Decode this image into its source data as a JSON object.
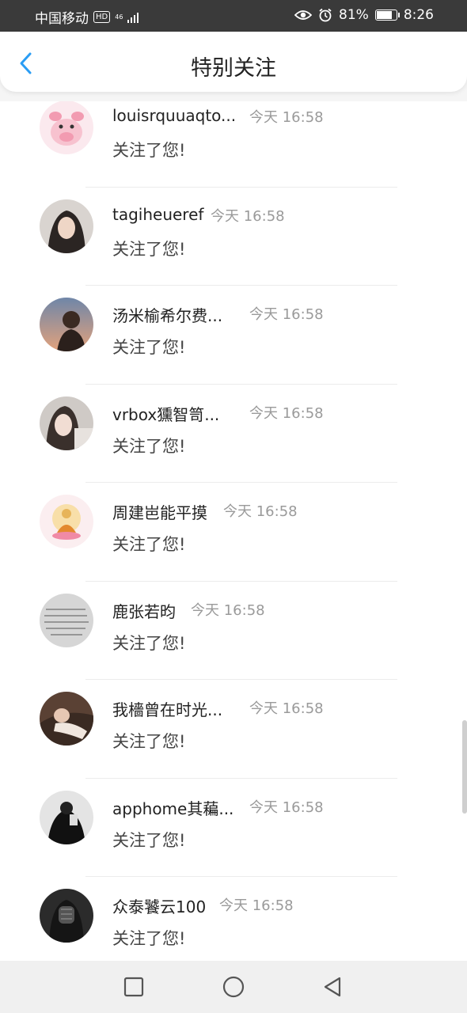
{
  "status_bar": {
    "carrier": "中国移动",
    "hd_badge": "HD",
    "network": "46",
    "battery": "81%",
    "battery_level": 0.81,
    "time": "8:26",
    "icons": [
      "eye-icon",
      "alarm-icon",
      "battery-icon"
    ]
  },
  "header": {
    "title": "特别关注",
    "back_icon": "chevron-left-icon"
  },
  "list": [
    {
      "name": "louisrquuaqto...",
      "time": "今天 16:58",
      "message": "关注了您!",
      "avatar": "pig-avatar"
    },
    {
      "name": "tagiheueref",
      "time": "今天 16:58",
      "message": "关注了您!",
      "avatar": "woman-portrait-avatar"
    },
    {
      "name": "汤米榆希尔费...",
      "time": "今天 16:58",
      "message": "关注了您!",
      "avatar": "sunset-portrait-avatar"
    },
    {
      "name": "vrbox獯智笥...",
      "time": "今天 16:58",
      "message": "关注了您!",
      "avatar": "girl-portrait-avatar"
    },
    {
      "name": "周建岜能平摸",
      "time": "今天 16:58",
      "message": "关注了您!",
      "avatar": "buddha-avatar"
    },
    {
      "name": "鹿张若昀",
      "time": "今天 16:58",
      "message": "关注了您!",
      "avatar": "calligraphy-avatar"
    },
    {
      "name": "我檣曾在时光...",
      "time": "今天 16:58",
      "message": "关注了您!",
      "avatar": "reclining-woman-avatar"
    },
    {
      "name": "apphome其藊...",
      "time": "今天 16:58",
      "message": "关注了您!",
      "avatar": "dark-figure-avatar"
    },
    {
      "name": "众泰饕云100",
      "time": "今天 16:58",
      "message": "关注了您!",
      "avatar": "kendo-mask-avatar"
    }
  ],
  "nav_bar": {
    "icons": [
      "recent-apps-icon",
      "home-icon",
      "back-icon"
    ]
  },
  "colors": {
    "accent": "#2a9df4",
    "time_text": "#9a9a9a",
    "status_bar_bg": "#3a3a3a"
  }
}
